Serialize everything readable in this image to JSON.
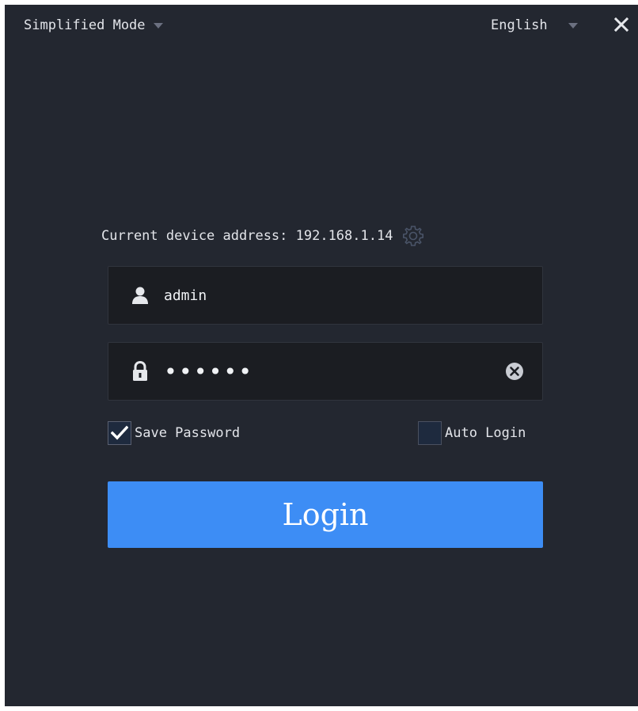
{
  "header": {
    "mode_label": "Simplified Mode",
    "language_label": "English"
  },
  "device": {
    "address_text": "Current device address: 192.168.1.14"
  },
  "login": {
    "username_value": "admin",
    "password_value": "••••••",
    "save_password_label": "Save Password",
    "save_password_checked": true,
    "auto_login_label": "Auto Login",
    "auto_login_checked": false,
    "button_label": "Login"
  },
  "icons": {
    "mode_dropdown": "chevron-down-icon",
    "language_dropdown": "chevron-down-icon",
    "close": "close-icon",
    "settings": "gear-icon",
    "user": "user-icon",
    "lock": "lock-icon",
    "clear": "clear-icon",
    "check": "checkmark-icon"
  },
  "colors": {
    "background": "#232730",
    "field_background": "#1b1d22",
    "accent": "#3d8df5",
    "text": "#e3e5ea"
  }
}
